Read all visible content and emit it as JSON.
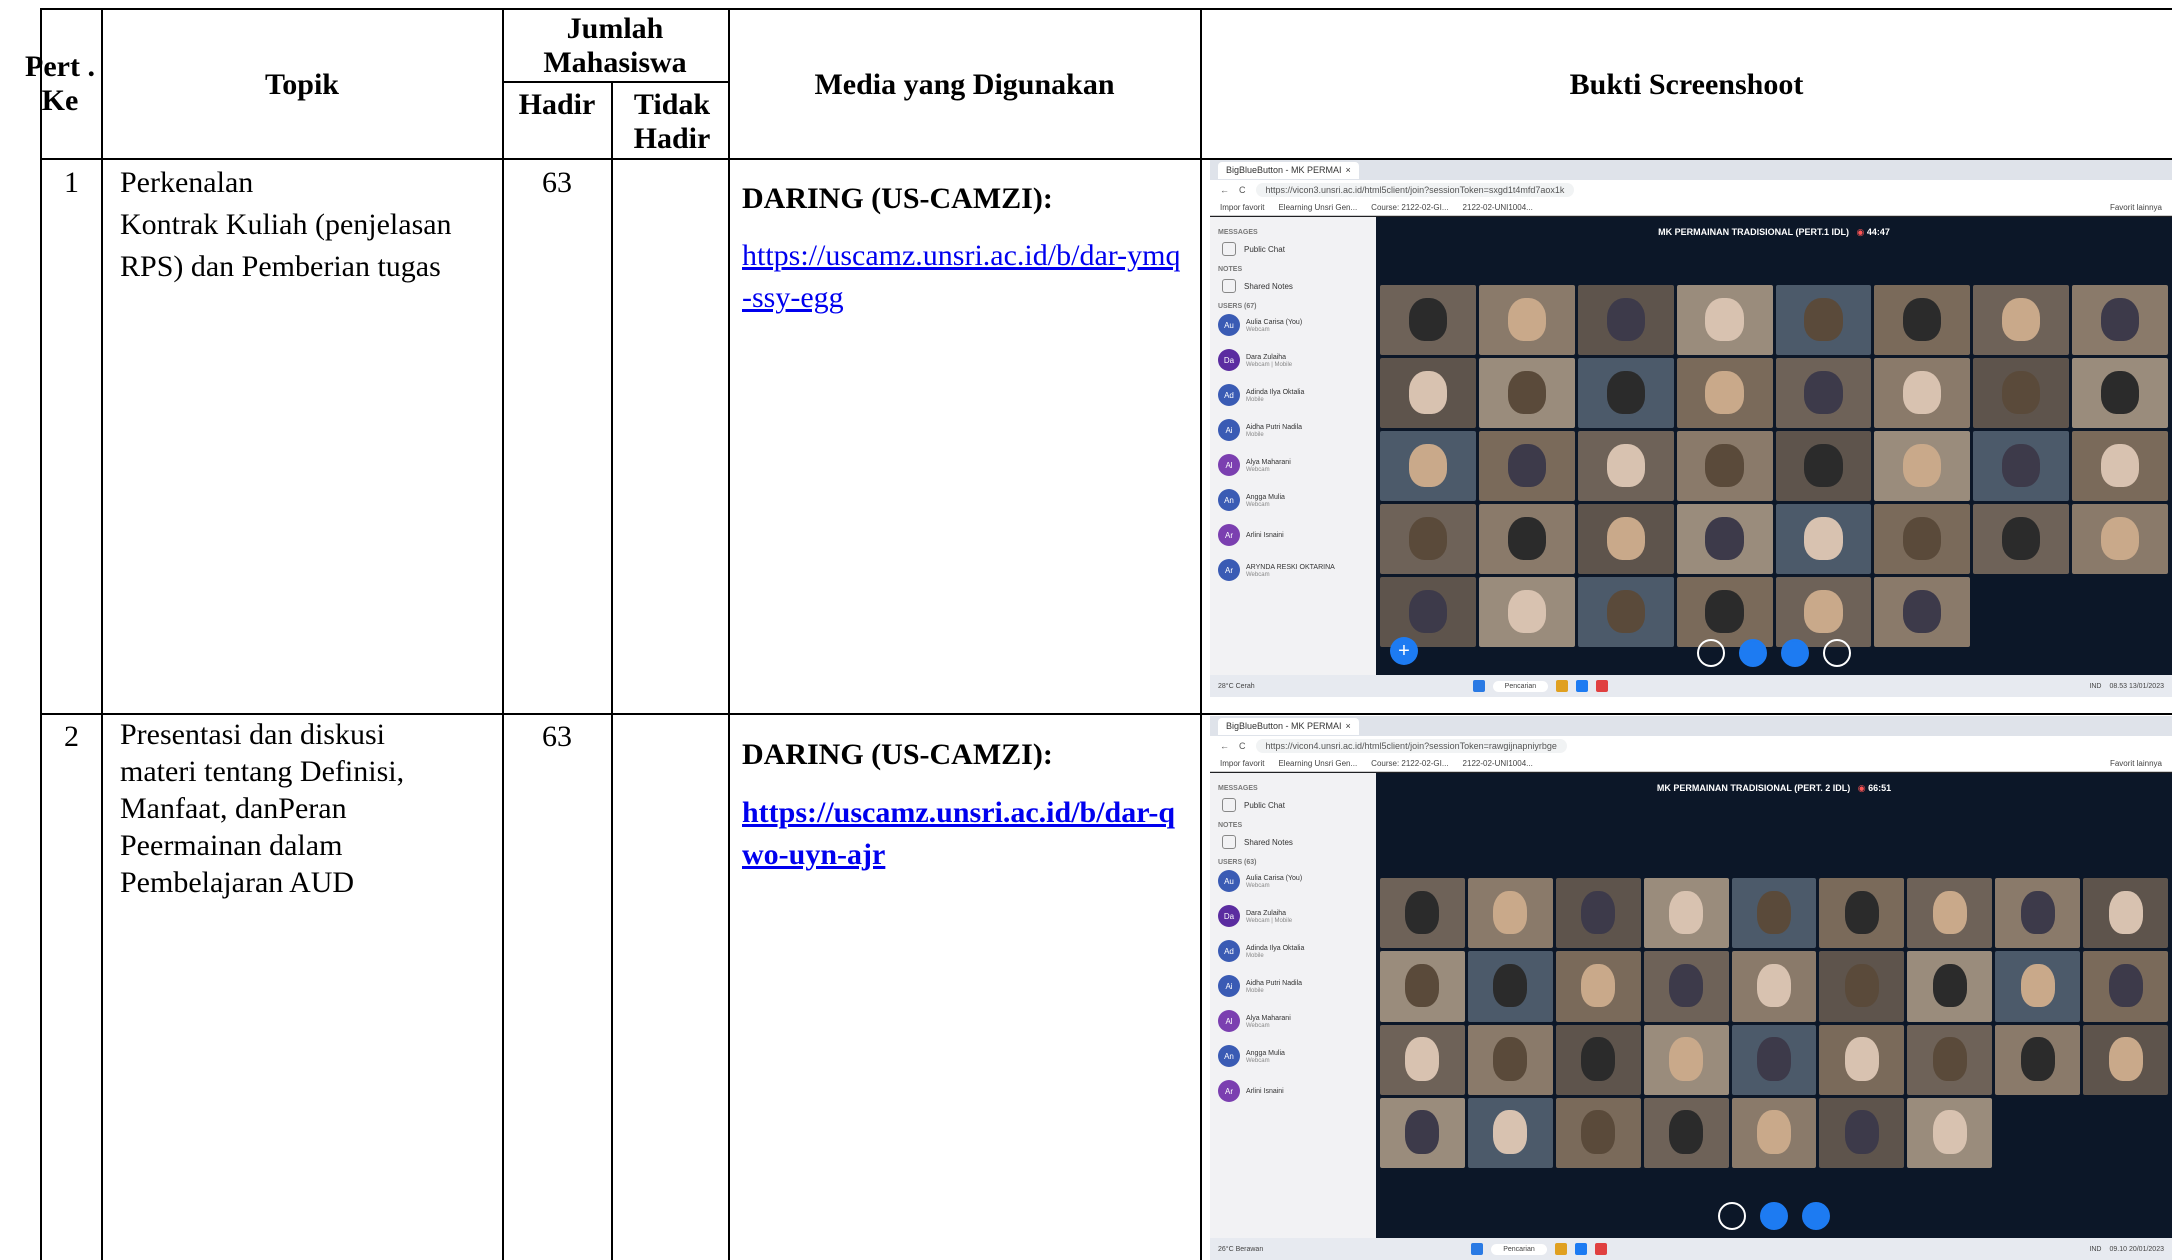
{
  "header": {
    "col_pert": "Pert . Ke",
    "col_topik": "Topik",
    "col_jumlah": "Jumlah Mahasiswa",
    "col_hadir": "Hadir",
    "col_tidak_hadir": "Tidak Hadir",
    "col_media": "Media yang Digunakan",
    "col_bukti": "Bukti Screenshoot"
  },
  "rows": [
    {
      "no": "1",
      "topik": "Perkenalan\nKontrak Kuliah (penjelasan RPS) dan Pemberian tugas",
      "hadir": "63",
      "tidak_hadir": "",
      "media_label": "DARING (US-CAMZI):",
      "media_link": "https://uscamz.unsri.ac.id/b/dar-ymq-ssy-egg",
      "screenshot": {
        "tab_title": "BigBlueButton - MK PERMAI",
        "url": "https://vicon3.unsri.ac.id/html5client/join?sessionToken=sxgd1t4mfd7aox1k",
        "meeting_title": "MK PERMAINAN TRADISIONAL (PERT.1 IDL)",
        "timer": "44:47",
        "users_count": "USERS (67)",
        "date": "13/01/2023",
        "time": "08.53",
        "weather": "28°C Cerah"
      }
    },
    {
      "no": "2",
      "topik": "Presentasi dan diskusi materi tentang Definisi, Manfaat, danPeran Peermainan dalam Pembelajaran AUD",
      "hadir": "63",
      "tidak_hadir": "",
      "media_label": "DARING (US-CAMZI):",
      "media_link": "https://uscamz.unsri.ac.id/b/dar-qwo-uyn-ajr",
      "screenshot": {
        "tab_title": "BigBlueButton - MK PERMAI",
        "url": "https://vicon4.unsri.ac.id/html5client/join?sessionToken=rawgijnapniyrbge",
        "meeting_title": "MK PERMAINAN TRADISIONAL (PERT. 2 IDL)",
        "timer": "66:51",
        "users_count": "USERS (63)",
        "date": "20/01/2023",
        "time": "09.10",
        "weather": "26°C Berawan"
      }
    }
  ],
  "ui": {
    "messages": "MESSAGES",
    "public_chat": "Public Chat",
    "notes": "NOTES",
    "shared_notes": "Shared Notes",
    "fav_import": "Impor favorit",
    "fav_elearning": "Elearning Unsri Gen...",
    "fav_course": "Course: 2122-02-GI...",
    "fav_course2": "2122-02-UNI1004...",
    "fav_other": "Favorit lainnya",
    "search": "Pencarian",
    "lang": "IND"
  },
  "users": [
    {
      "ini": "Au",
      "name": "Aulia Carisa (You)",
      "sub": "Webcam"
    },
    {
      "ini": "Da",
      "name": "Dara Zulaiha",
      "sub": "Webcam | Mobile"
    },
    {
      "ini": "Ad",
      "name": "Adinda Ilya Oktalia",
      "sub": "Mobile"
    },
    {
      "ini": "Ai",
      "name": "Aidha Putri Nadila",
      "sub": "Mobile"
    },
    {
      "ini": "Al",
      "name": "Alya Maharani",
      "sub": "Webcam"
    },
    {
      "ini": "An",
      "name": "Angga Mulia",
      "sub": "Webcam"
    },
    {
      "ini": "Ar",
      "name": "Arlini Isnaini",
      "sub": ""
    },
    {
      "ini": "Ar",
      "name": "ARYNDA RESKI OKTARINA",
      "sub": "Webcam"
    }
  ]
}
